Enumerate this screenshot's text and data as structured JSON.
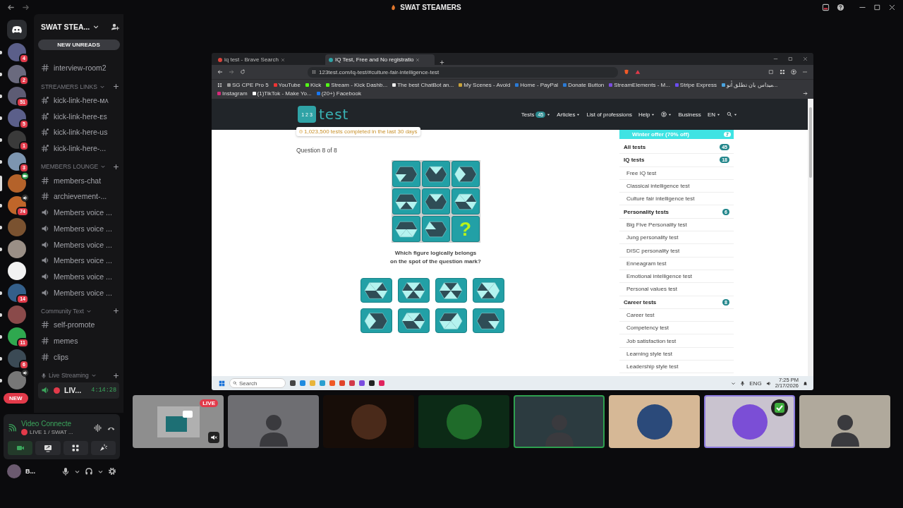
{
  "app_title": "SWAT STEAMERS",
  "servers": [
    {
      "badge": "4",
      "unread": true,
      "selected": false,
      "live_video": false,
      "voice": false
    },
    {
      "badge": "2",
      "unread": true,
      "selected": false,
      "live_video": false,
      "voice": false
    },
    {
      "badge": "51",
      "unread": true,
      "selected": false,
      "live_video": false,
      "voice": false
    },
    {
      "badge": "5",
      "unread": true,
      "selected": false,
      "live_video": false,
      "voice": false
    },
    {
      "badge": "1",
      "unread": true,
      "selected": false,
      "live_video": false,
      "voice": false
    },
    {
      "badge": "3",
      "unread": true,
      "selected": false,
      "live_video": false,
      "voice": false
    },
    {
      "unread": false,
      "selected": true,
      "live_video": true,
      "voice": false
    },
    {
      "badge": "74",
      "unread": true,
      "selected": false,
      "live_video": false,
      "voice": true
    },
    {
      "unread": true,
      "selected": false,
      "live_video": false,
      "voice": false
    },
    {
      "unread": true,
      "selected": false,
      "live_video": false,
      "voice": false
    },
    {
      "unread": false,
      "selected": false,
      "live_video": false,
      "voice": false
    },
    {
      "badge": "14",
      "unread": true,
      "selected": false,
      "live_video": false,
      "voice": false
    },
    {
      "unread": true,
      "selected": false,
      "live_video": false,
      "voice": false
    },
    {
      "badge": "11",
      "unread": true,
      "selected": false,
      "live_video": false,
      "voice": false
    },
    {
      "badge": "6",
      "unread": true,
      "selected": false,
      "live_video": false,
      "voice": false
    },
    {
      "unread": true,
      "selected": false,
      "live_video": false,
      "voice": true
    }
  ],
  "new_pill": "NEW",
  "server_name": "SWAT STEA...",
  "new_unreads": "NEW UNREADS",
  "channels": [
    {
      "kind": "text",
      "label": "interview-room2"
    },
    {
      "kind": "category",
      "label": "STREAMERS LINKS"
    },
    {
      "kind": "thread",
      "label": "kick-link-here-ᴍᴀ"
    },
    {
      "kind": "thread",
      "label": "kick-link-here-ᴇs"
    },
    {
      "kind": "thread",
      "label": "kick-link-here-us"
    },
    {
      "kind": "thread",
      "label": "kick-link-here-..."
    },
    {
      "kind": "category",
      "label": "MEMBERS LOUNGE"
    },
    {
      "kind": "text",
      "label": "members-chat"
    },
    {
      "kind": "text",
      "label": "archievement-..."
    },
    {
      "kind": "voice",
      "label": "Members voice ..."
    },
    {
      "kind": "voice",
      "label": "Members voice ..."
    },
    {
      "kind": "voice",
      "label": "Members voice ..."
    },
    {
      "kind": "voice",
      "label": "Members voice ..."
    },
    {
      "kind": "voice",
      "label": "Members voice ..."
    },
    {
      "kind": "voice",
      "label": "Members voice ..."
    },
    {
      "kind": "category",
      "label": "Community Text"
    },
    {
      "kind": "text",
      "label": "self-promote"
    },
    {
      "kind": "text",
      "label": "memes"
    },
    {
      "kind": "text",
      "label": "clips"
    },
    {
      "kind": "voice_category",
      "label": "Live Streaming"
    },
    {
      "kind": "live",
      "label": "LIV...",
      "time": "4:14:28"
    }
  ],
  "voice_panel": {
    "status": "Video Connecte",
    "channel": "LIVE 1 / SWAT ...",
    "controls": [
      {
        "kind": "camera",
        "on": true
      },
      {
        "kind": "screen",
        "on": false
      },
      {
        "kind": "activities",
        "on": false
      },
      {
        "kind": "soundboard",
        "on": false
      }
    ]
  },
  "user": {
    "name": "B..."
  },
  "browser": {
    "tabs": [
      {
        "title": "iq test - Brave Search",
        "selected": false
      },
      {
        "title": "IQ Test, Free and No registratio",
        "selected": true
      }
    ],
    "url": "123test.com/iq-test/#culture-fair-intelligence-test",
    "bookmarks": [
      "SG CPE Pro 5",
      "YouTube",
      "Kick",
      "Stream - Kick Dashb...",
      "The best ChatBot an...",
      "My Scenes - Avoid",
      "Home - PayPal",
      "Donate Button",
      "StreamElements - M...",
      "Stripe Express",
      "ميداس بان تطلق أنو...",
      "Instagram",
      "(1)TikTok - Make Yo...",
      "(20+) Facebook"
    ],
    "site": {
      "logo": "test",
      "cube": [
        "1",
        "2",
        "3"
      ],
      "counter": "1,023,500 tests completed in the last 30 days",
      "nav": [
        {
          "kind": "link",
          "label": "Tests",
          "badge": "45",
          "dropdown": true
        },
        {
          "kind": "link",
          "label": "Articles",
          "dropdown": true
        },
        {
          "kind": "link",
          "label": "List of professions",
          "dropdown": false
        },
        {
          "kind": "link",
          "label": "Help",
          "dropdown": true
        },
        {
          "kind": "account",
          "dropdown": true
        },
        {
          "kind": "link",
          "label": "Business",
          "dropdown": false
        },
        {
          "kind": "link",
          "label": "EN",
          "dropdown": true
        },
        {
          "kind": "search",
          "dropdown": true
        }
      ],
      "question": "Question 8 of 8",
      "missing_mark": "?",
      "prompt": "Which figure logically belongs\non the spot of the question mark?",
      "offer": {
        "label": "Winter offer (70% off)",
        "badge": "7"
      },
      "menu": [
        {
          "kind": "group",
          "label": "All tests",
          "badge": "45"
        },
        {
          "kind": "group",
          "label": "IQ tests",
          "badge": "18"
        },
        {
          "kind": "item",
          "label": "Free IQ test"
        },
        {
          "kind": "item",
          "label": "Classical intelligence test"
        },
        {
          "kind": "item",
          "label": "Culture fair intelligence test"
        },
        {
          "kind": "group",
          "label": "Personality tests",
          "badge": "6"
        },
        {
          "kind": "item",
          "label": "Big Five Personality test"
        },
        {
          "kind": "item",
          "label": "Jung personality test"
        },
        {
          "kind": "item",
          "label": "DISC personality test"
        },
        {
          "kind": "item",
          "label": "Enneagram test"
        },
        {
          "kind": "item",
          "label": "Emotional intelligence test"
        },
        {
          "kind": "item",
          "label": "Personal values test"
        },
        {
          "kind": "group",
          "label": "Career tests",
          "badge": "8"
        },
        {
          "kind": "item",
          "label": "Career test"
        },
        {
          "kind": "item",
          "label": "Competency test"
        },
        {
          "kind": "item",
          "label": "Job satisfaction test"
        },
        {
          "kind": "item",
          "label": "Learning style test"
        },
        {
          "kind": "item",
          "label": "Leadership style test"
        }
      ]
    },
    "taskbar": {
      "search": "Search",
      "language": "ENG",
      "time": "7:25 PM",
      "date": "2/17/2026"
    }
  },
  "video_tiles": [
    {
      "kind": "screen",
      "badge": "LIVE",
      "muted": true,
      "speaking": false,
      "selected": false,
      "checked": false
    },
    {
      "kind": "camera",
      "muted": false,
      "speaking": false,
      "selected": false,
      "checked": false
    },
    {
      "kind": "avatar",
      "muted": false,
      "speaking": false,
      "selected": false,
      "checked": false
    },
    {
      "kind": "avatar",
      "muted": false,
      "speaking": false,
      "selected": false,
      "checked": false
    },
    {
      "kind": "camera",
      "muted": false,
      "speaking": true,
      "selected": false,
      "checked": false
    },
    {
      "kind": "avatar",
      "muted": false,
      "speaking": false,
      "selected": false,
      "checked": false
    },
    {
      "kind": "avatar",
      "muted": false,
      "speaking": false,
      "selected": true,
      "checked": true
    },
    {
      "kind": "camera",
      "muted": false,
      "speaking": false,
      "selected": false,
      "checked": false
    }
  ]
}
